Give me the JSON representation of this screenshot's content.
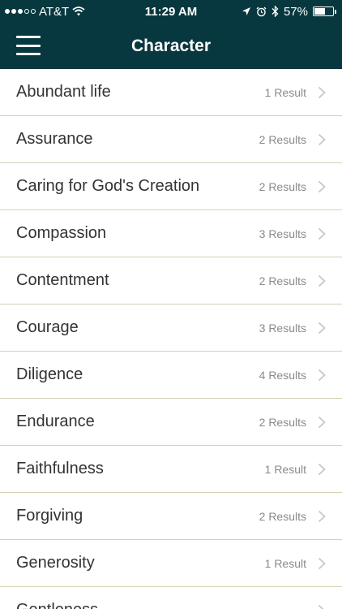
{
  "status": {
    "carrier": "AT&T",
    "time": "11:29 AM",
    "battery": "57%",
    "battery_level": 0.57,
    "icons": [
      "signal-dots-icon",
      "wifi-icon",
      "location-arrow-icon",
      "alarm-icon",
      "bluetooth-icon",
      "battery-icon"
    ]
  },
  "header": {
    "title": "Character",
    "menu_icon": "hamburger-menu-icon"
  },
  "colors": {
    "header_bg": "#07383f",
    "divider": "#d6d1b4",
    "label": "#333333",
    "count": "#8a8a8a"
  },
  "items": [
    {
      "label": "Abundant life",
      "count": "1 Result"
    },
    {
      "label": "Assurance",
      "count": "2 Results"
    },
    {
      "label": "Caring for God's Creation",
      "count": "2 Results"
    },
    {
      "label": "Compassion",
      "count": "3 Results"
    },
    {
      "label": "Contentment",
      "count": "2 Results"
    },
    {
      "label": "Courage",
      "count": "3 Results"
    },
    {
      "label": "Diligence",
      "count": "4 Results"
    },
    {
      "label": "Endurance",
      "count": "2 Results"
    },
    {
      "label": "Faithfulness",
      "count": "1 Result"
    },
    {
      "label": "Forgiving",
      "count": "2 Results"
    },
    {
      "label": "Generosity",
      "count": "1 Result"
    },
    {
      "label": "Gentleness",
      "count": ""
    }
  ]
}
